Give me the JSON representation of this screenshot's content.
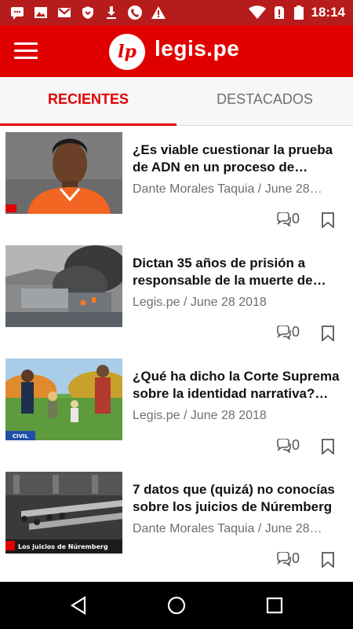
{
  "status_bar": {
    "time": "18:14",
    "left_icons": [
      "message-icon",
      "image-icon",
      "gmail-icon",
      "shield-icon",
      "download-icon",
      "phone-icon",
      "warning-icon"
    ],
    "right_icons": [
      "wifi-icon",
      "no-sim-icon",
      "battery-icon"
    ]
  },
  "app_bar": {
    "logo_text": "lp",
    "brand": "legis.pe"
  },
  "tabs": [
    {
      "label": "RECIENTES",
      "active": true
    },
    {
      "label": "DESTACADOS",
      "active": false
    }
  ],
  "articles": [
    {
      "title": "¿Es viable cuestionar la prueba de ADN en un proceso de…",
      "meta": "Dante Morales Taquia / June 28…",
      "comments": "0",
      "thumbnail": "portrait of a footballer in an orange jersey"
    },
    {
      "title": "Dictan 35 años de prisión a responsable de la muerte de…",
      "meta": "Legis.pe / June 28 2018",
      "comments": "0",
      "thumbnail": "smoke rising from a burning building"
    },
    {
      "title": "¿Qué ha dicho la Corte Suprema sobre la identidad narrativa?…",
      "meta": "Legis.pe / June 28 2018",
      "comments": "0",
      "thumbnail": "family walking in a park",
      "badge": "CIVIL"
    },
    {
      "title": "7 datos que (quizá) no conocías sobre los juicios de Núremberg",
      "meta": "Dante Morales Taquia / June 28…",
      "comments": "0",
      "thumbnail": "courtroom of the Nuremberg trials",
      "caption": "Los juicios de Núremberg"
    }
  ],
  "colors": {
    "brand_red": "#e10000",
    "status_red": "#b71c1c",
    "meta_gray": "#6f6f6f"
  }
}
